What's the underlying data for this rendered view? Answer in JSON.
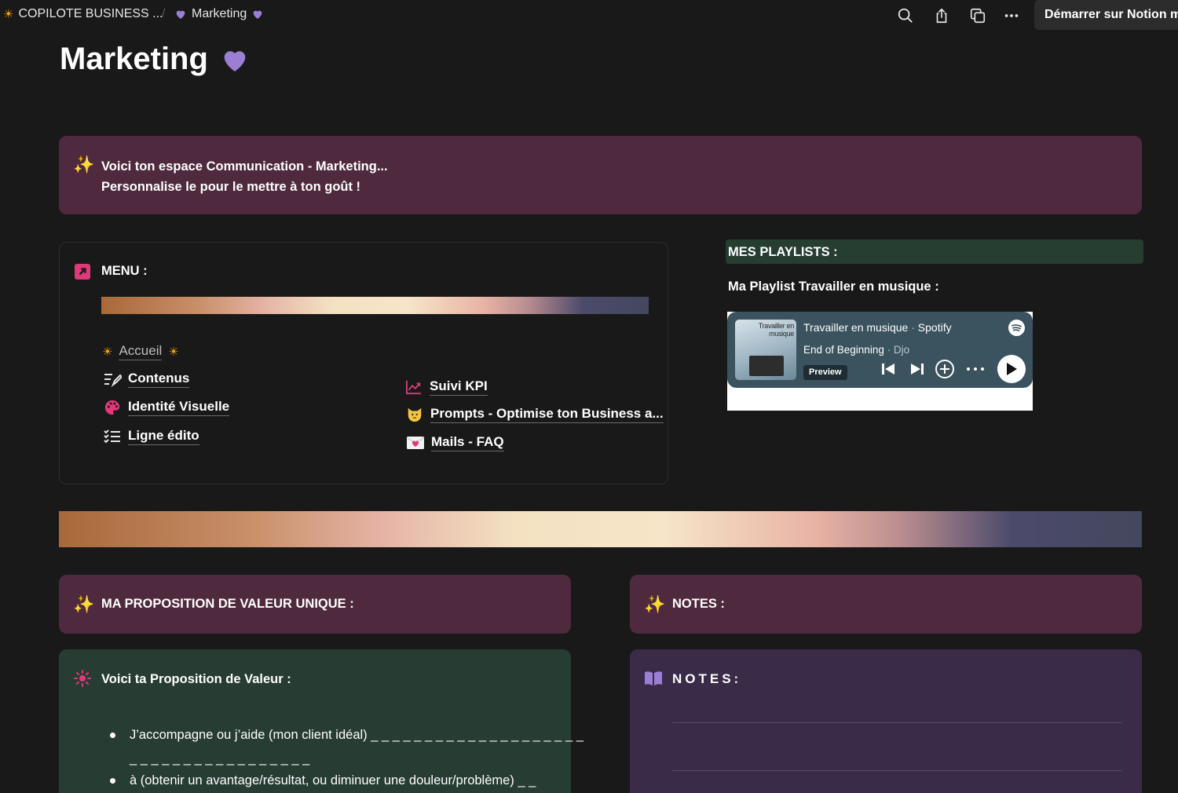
{
  "topbar": {
    "workspace": "COPILOTE BUSINESS ...",
    "separator": "/",
    "page": "Marketing",
    "notion_button": "Démarrer sur Notion m"
  },
  "page_title": "Marketing",
  "intro": {
    "line1": "Voici ton espace Communication - Marketing...",
    "line2": "Personnalise le pour le mettre à ton goût !"
  },
  "menu": {
    "title": "MENU :",
    "left_links": [
      "Accueil",
      "Contenus",
      "Identité Visuelle",
      "Ligne édito"
    ],
    "right_links": [
      "Suivi KPI",
      "Prompts - Optimise ton Business a...",
      "Mails - FAQ"
    ]
  },
  "playlists": {
    "header": "MES PLAYLISTS :",
    "subtitle": "Ma Playlist Travailler en musique :",
    "embed": {
      "cover_text_1": "Travailler en",
      "cover_text_2": "musique",
      "playlist_name": "Travailler en musique",
      "dot": "·",
      "platform": "Spotify",
      "track": "End of Beginning",
      "artist": "Djo",
      "preview_label": "Preview"
    }
  },
  "value_prop": {
    "header": "MA PROPOSITION DE VALEUR UNIQUE   :",
    "box_title": "Voici ta Proposition de Valeur :",
    "bullet1_line1": "J’accompagne ou j’aide (mon client idéal) _ _ _ _ _ _ _ _ _ _ _ _ _ _ _ _ _ _ _ _",
    "bullet1_line2": "_ _ _ _ _ _ _ _ _ _ _ _ _ _ _ _ _",
    "bullet2": "à (obtenir un avantage/résultat, ou diminuer une douleur/problème)  _ _"
  },
  "notes": {
    "header": "NOTES :",
    "label": "NOTES:"
  },
  "colors": {
    "background": "#191919",
    "wine_callout": "#4f2a3e",
    "green_callout": "#273c33",
    "purple_callout": "#3a2b48",
    "accent_pink": "#e0397a",
    "heart_purple": "#9b7fd4"
  }
}
